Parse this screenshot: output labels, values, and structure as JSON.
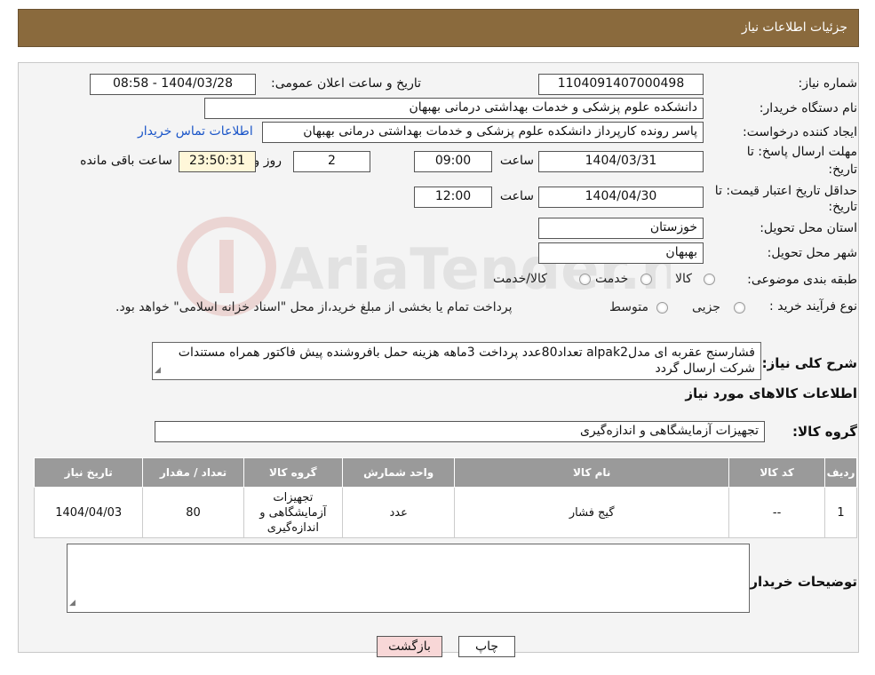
{
  "header": {
    "title": "جزئیات اطلاعات نیاز"
  },
  "form": {
    "need_number_label": "شماره نیاز:",
    "need_number": "1104091407000498",
    "announce_label": "تاریخ و ساعت اعلان عمومی:",
    "announce_value": "1404/03/28 - 08:58",
    "buyer_label": "نام دستگاه خریدار:",
    "buyer_value": "دانشکده علوم پزشکی و خدمات بهداشتی  درمانی بهبهان",
    "creator_label": "ایجاد کننده درخواست:",
    "creator_value": "پاسر رونده کارپرداز دانشکده علوم پزشکی و خدمات بهداشتی  درمانی بهبهان",
    "contact_link": "اطلاعات تماس خریدار",
    "deadline_label_1": "مهلت ارسال پاسخ: تا",
    "deadline_label_2": "تاریخ:",
    "deadline_date": "1404/03/31",
    "time_label": "ساعت",
    "deadline_time": "09:00",
    "days_value": "2",
    "days_label": "روز و",
    "remaining_time": "23:50:31",
    "remaining_label": "ساعت باقی مانده",
    "validity_label_1": "حداقل تاریخ اعتبار قیمت: تا",
    "validity_label_2": "تاریخ:",
    "validity_date": "1404/04/30",
    "validity_time": "12:00",
    "province_label": "استان محل تحویل:",
    "province_value": "خوزستان",
    "city_label": "شهر محل تحویل:",
    "city_value": "بهبهان",
    "category_label": "طبقه بندی موضوعی:",
    "category_options": [
      "کالا",
      "خدمت",
      "کالا/خدمت"
    ],
    "process_label": "نوع فرآیند خرید :",
    "process_options": [
      "جزیی",
      "متوسط"
    ],
    "process_note": "پرداخت تمام یا بخشی از مبلغ خرید،از محل \"اسناد خزانه اسلامی\" خواهد بود."
  },
  "description": {
    "label": "شرح کلی نیاز:",
    "text": "فشارسنج عقربه ای مدلalpak2 تعداد80عدد پرداخت 3ماهه هزینه حمل بافروشنده پیش فاکتور همراه مستندات شرکت ارسال گردد"
  },
  "goods_section": {
    "title": "اطلاعات کالاهای مورد نیاز",
    "group_label": "گروه کالا:",
    "group_value": "تجهیزات آزمایشگاهی و اندازه‌گیری"
  },
  "table": {
    "headers": [
      "ردیف",
      "کد کالا",
      "نام کالا",
      "واحد شمارش",
      "گروه کالا",
      "تعداد / مقدار",
      "تاریخ نیاز"
    ],
    "rows": [
      [
        "1",
        "--",
        "گیج فشار",
        "عدد",
        "تجهیزات آزمایشگاهی و اندازه‌گیری",
        "80",
        "1404/04/03"
      ]
    ]
  },
  "buyer_notes": {
    "label": "توضیحات خریدار:",
    "text": ""
  },
  "buttons": {
    "print": "چاپ",
    "back": "بازگشت"
  },
  "watermark": {
    "text": "AriaTender.neT"
  },
  "colors": {
    "header_bg": "#8a6a3d",
    "table_header_bg": "#9a9a9a",
    "back_button_bg": "#f8d7d7",
    "link": "#1a55c8"
  }
}
